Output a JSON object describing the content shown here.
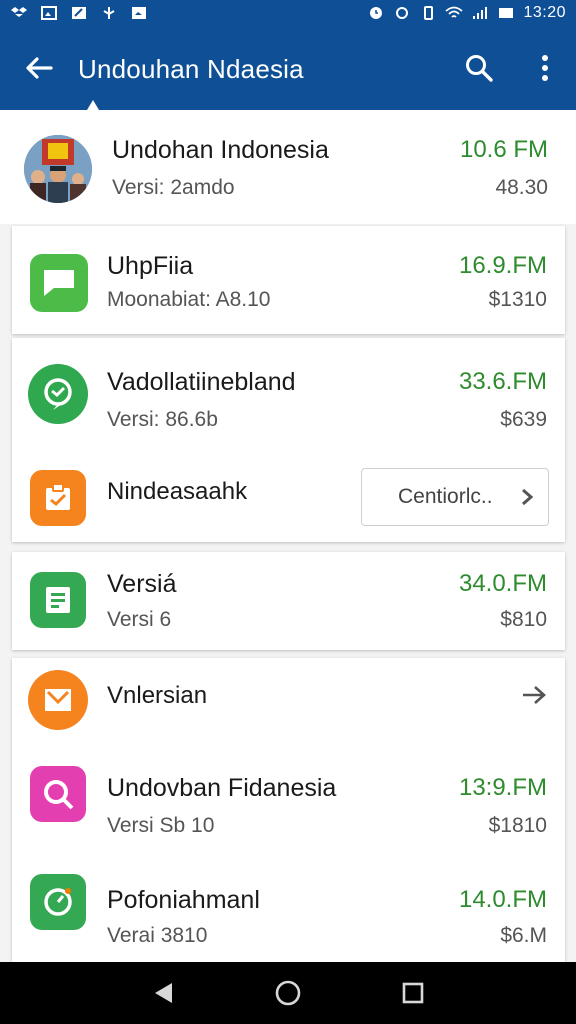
{
  "status_bar": {
    "time": "13:20"
  },
  "app_bar": {
    "title": "Undouhan Ndaesia"
  },
  "featured": {
    "name": "Undohan Indonesia",
    "version": "Versi: 2amdo",
    "size": "10.6 FM",
    "price": "48.30"
  },
  "apps": [
    {
      "name": "UhpFiia",
      "sub": "Moonabiat: A8.10",
      "size": "16.9.FM",
      "price": "$1310",
      "color": "#4cbb47"
    },
    {
      "name": "Vadollatiinebland",
      "sub": "Versi: 86.6b",
      "size": "33.6.FM",
      "price": "$639",
      "color": "#2fa84f"
    },
    {
      "name": "Nindeasaahk",
      "button": "Centiorlc..",
      "color": "#f5841f"
    },
    {
      "name": "Versiá",
      "sub": "Versi 6",
      "size": "34.0.FM",
      "price": "$810",
      "color": "#34a853"
    },
    {
      "name": "Vnlersian",
      "color": "#f5841f"
    },
    {
      "name": "Undovban Fidanesia",
      "sub": "Versi Sb 10",
      "size": "13:9.FM",
      "price": "$1810",
      "color": "#e33fb1"
    },
    {
      "name": "Pofoniahmanl",
      "sub": "Verai 3810",
      "size": "14.0.FM",
      "price": "$6.M",
      "color": "#34a853"
    }
  ]
}
